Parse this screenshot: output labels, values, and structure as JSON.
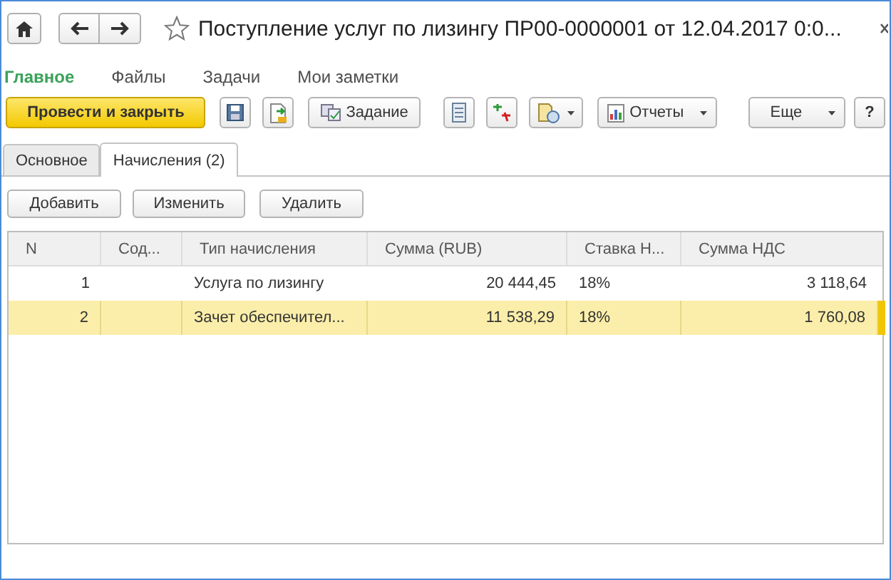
{
  "window": {
    "title": "Поступление услуг по лизингу ПР00-0000001 от 12.04.2017 0:0..."
  },
  "sections": [
    {
      "label": "Главное",
      "selected": true
    },
    {
      "label": "Файлы",
      "selected": false
    },
    {
      "label": "Задачи",
      "selected": false
    },
    {
      "label": "Мои заметки",
      "selected": false
    }
  ],
  "toolbar": {
    "post_close": "Провести и закрыть",
    "task": "Задание",
    "reports": "Отчеты",
    "more": "Еще",
    "help": "?"
  },
  "tabs": [
    {
      "label": "Основное",
      "selected": false
    },
    {
      "label": "Начисления (2)",
      "selected": true
    }
  ],
  "table_buttons": [
    "Добавить",
    "Изменить",
    "Удалить"
  ],
  "table": {
    "columns": [
      "N",
      "Сод...",
      "Тип начисления",
      "Сумма (RUB)",
      "Ставка Н...",
      "Сумма НДС"
    ],
    "rows": [
      {
        "cells": [
          "1",
          "",
          "Услуга по лизингу",
          "20 444,45",
          "18%",
          "3 118,64"
        ],
        "selected": false
      },
      {
        "cells": [
          "2",
          "",
          "Зачет обеспечител...",
          "11 538,29",
          "18%",
          "1 760,08"
        ],
        "selected": true
      }
    ]
  }
}
